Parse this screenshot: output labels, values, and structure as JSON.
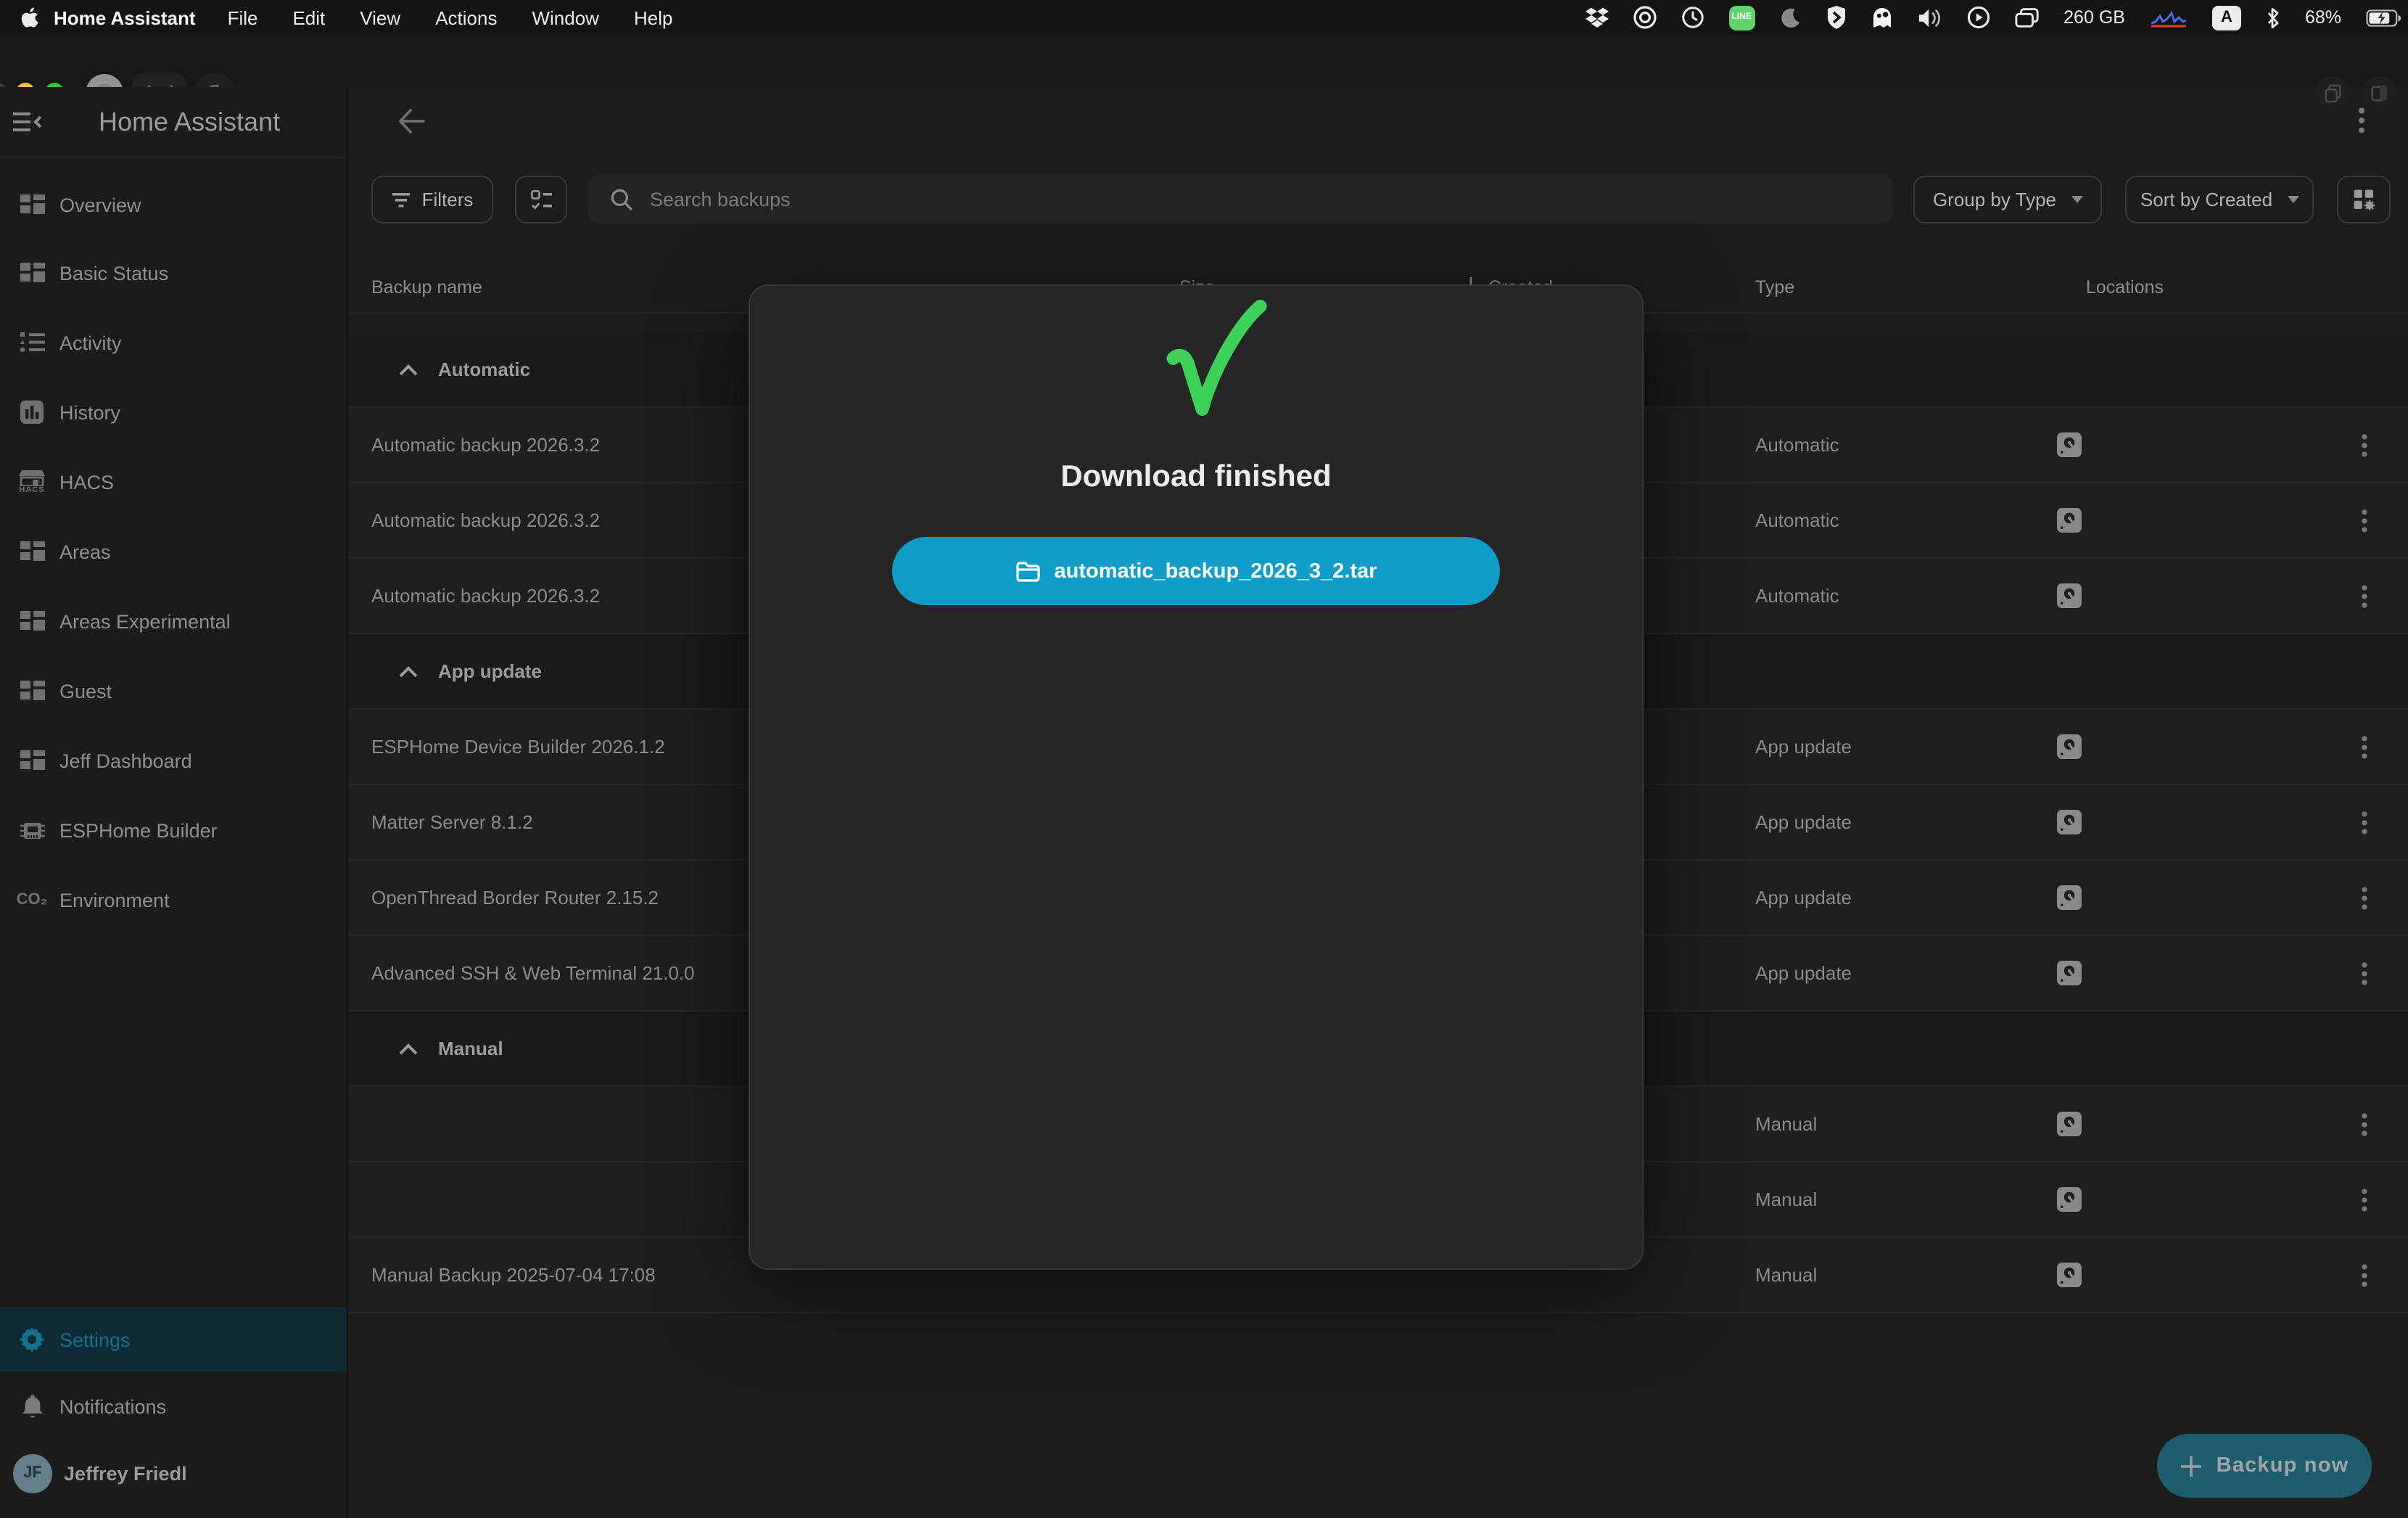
{
  "menubar": {
    "app_name": "Home Assistant",
    "menus": [
      "File",
      "Edit",
      "View",
      "Actions",
      "Window",
      "Help"
    ],
    "storage": "260 GB",
    "input_key": "A",
    "battery_pct": "68%",
    "line_label": "LINE"
  },
  "sidebar": {
    "title": "Home Assistant",
    "items": [
      {
        "label": "Overview"
      },
      {
        "label": "Basic Status"
      },
      {
        "label": "Activity"
      },
      {
        "label": "History"
      },
      {
        "label": "HACS"
      },
      {
        "label": "Areas"
      },
      {
        "label": "Areas Experimental"
      },
      {
        "label": "Guest"
      },
      {
        "label": "Jeff Dashboard"
      },
      {
        "label": "ESPHome Builder"
      },
      {
        "label": "Environment"
      }
    ],
    "hacs_icon_text": "HACS",
    "co2_icon_text": "CO₂",
    "settings_label": "Settings",
    "notifications_label": "Notifications",
    "user": {
      "initials": "JF",
      "name": "Jeffrey Friedl"
    }
  },
  "toolbar": {
    "filters_label": "Filters",
    "search_placeholder": "Search backups",
    "group_by_label": "Group by Type",
    "sort_by_label": "Sort by Created"
  },
  "table": {
    "columns": [
      "Backup name",
      "Size",
      "Created",
      "Type",
      "Locations"
    ],
    "groups": [
      {
        "name": "Automatic",
        "rows": [
          {
            "name": "Automatic backup 2026.3.2",
            "type": "Automatic"
          },
          {
            "name": "Automatic backup 2026.3.2",
            "type": "Automatic"
          },
          {
            "name": "Automatic backup 2026.3.2",
            "type": "Automatic"
          }
        ]
      },
      {
        "name": "App update",
        "rows": [
          {
            "name": "ESPHome Device Builder 2026.1.2",
            "type": "App update"
          },
          {
            "name": "Matter Server 8.1.2",
            "type": "App update"
          },
          {
            "name": "OpenThread Border Router 2.15.2",
            "type": "App update"
          },
          {
            "name": "Advanced SSH & Web Terminal 21.0.0",
            "type": "App update"
          }
        ]
      },
      {
        "name": "Manual",
        "rows": [
          {
            "name": "",
            "type": "Manual"
          },
          {
            "name": "",
            "type": "Manual"
          },
          {
            "name": "Manual Backup 2025-07-04 17:08",
            "type": "Manual"
          }
        ]
      }
    ]
  },
  "dialog": {
    "title": "Download finished",
    "file_name": "automatic_backup_2026_3_2.tar"
  },
  "fab": {
    "label": "Backup now"
  },
  "colors": {
    "accent_blue": "#119dc9",
    "success_green": "#3ed15a",
    "settings_teal": "#17708c",
    "fab_teal": "#1e5d6d"
  }
}
